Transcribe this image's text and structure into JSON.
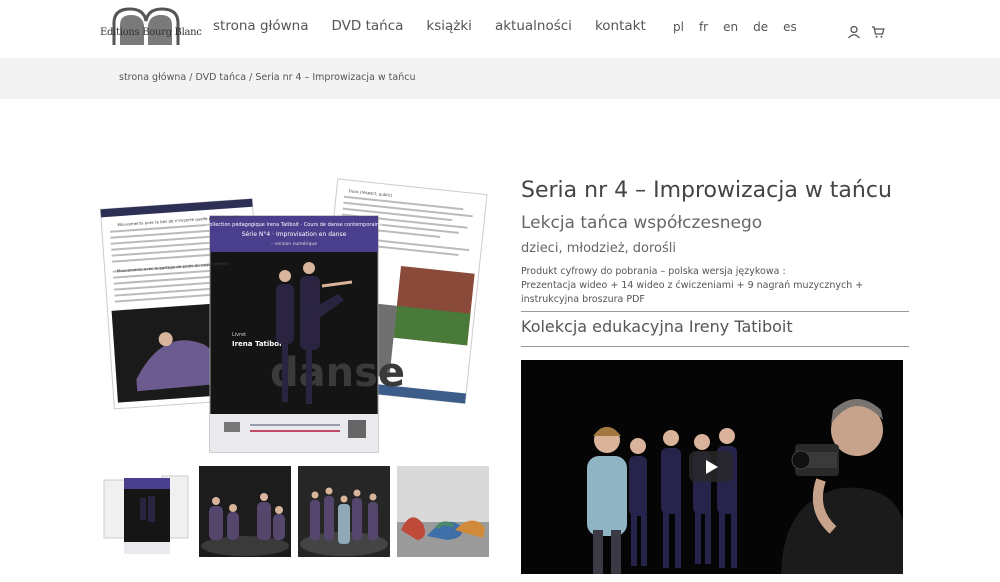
{
  "header": {
    "logo_text": "Editions Bourg Blanc",
    "nav": [
      {
        "label": "strona główna"
      },
      {
        "label": "DVD tańca"
      },
      {
        "label": "książki"
      },
      {
        "label": "aktualności"
      },
      {
        "label": "kontakt"
      }
    ],
    "languages": [
      "pl",
      "fr",
      "en",
      "de",
      "es"
    ],
    "icons": [
      "user-icon",
      "cart-icon"
    ]
  },
  "breadcrumb": {
    "home": "strona główna",
    "category": "DVD tańca",
    "current": "Seria nr 4 – Improwizacja w tańcu",
    "sep": " / "
  },
  "product": {
    "title": "Seria nr 4 – Improwizacja w tańcu",
    "subtitle": "Lekcja tańca współczesnego",
    "audience": "dzieci, młodzież, dorośli",
    "desc_line1": "Produkt cyfrowy do pobrania – polska wersja językowa :",
    "desc_line2": "Prezentacja wideo + 14 wideo z ćwiczeniami + 9 nagrań muzycznych + instrukcyjna broszura PDF",
    "collection": "Kolekcja edukacyjna Ireny Tatiboit"
  },
  "booklet": {
    "cover_line1": "Collection pédagogique Irena Tatiboit · Cours de danse contemporaine",
    "cover_line2": "Série N°4 · Improvisation en danse",
    "cover_line3": "– version numérique",
    "author_label": "Livret",
    "author": "Irena Tatiboit",
    "watermark": "danse",
    "left_page_heading": "Mouvements avec le bas de n'importe quelle partie du corps",
    "left_page_heading2": "Mouvements avec le partage de poids du corps comme",
    "right_page_heading": "Duos (respect, public)"
  },
  "colors": {
    "accent_purple": "#4a3f8c",
    "rule": "#999999",
    "crumb_band": "#f3f3f3"
  }
}
